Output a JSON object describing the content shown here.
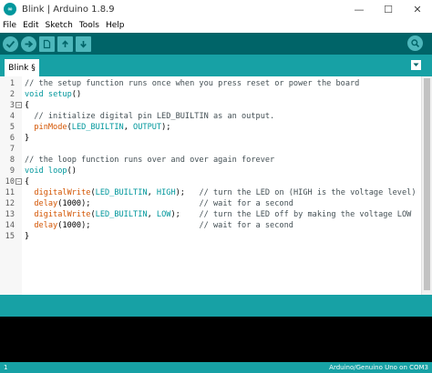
{
  "window": {
    "title": "Blink | Arduino 1.8.9",
    "minimize": "—",
    "maximize": "☐",
    "close": "✕"
  },
  "menu": [
    "File",
    "Edit",
    "Sketch",
    "Tools",
    "Help"
  ],
  "toolbar": {
    "verify_icon": "check-icon",
    "upload_icon": "arrow-right-icon",
    "new_icon": "file-icon",
    "open_icon": "arrow-up-icon",
    "save_icon": "arrow-down-icon",
    "serial_icon": "magnifier-icon"
  },
  "tabs": [
    {
      "label": "Blink §"
    }
  ],
  "editor": {
    "lines": [
      {
        "n": "1",
        "fold": "",
        "parts": [
          [
            "c-comment",
            "// the setup function runs once when you press reset or power the board"
          ]
        ]
      },
      {
        "n": "2",
        "fold": "",
        "parts": [
          [
            "c-kw",
            "void"
          ],
          [
            "c-plain",
            " "
          ],
          [
            "c-kw",
            "setup"
          ],
          [
            "c-plain",
            "()"
          ]
        ]
      },
      {
        "n": "3",
        "fold": "−",
        "parts": [
          [
            "c-plain",
            "{"
          ]
        ]
      },
      {
        "n": "4",
        "fold": "",
        "parts": [
          [
            "c-plain",
            "  "
          ],
          [
            "c-comment",
            "// initialize digital pin LED_BUILTIN as an output."
          ]
        ]
      },
      {
        "n": "5",
        "fold": "",
        "parts": [
          [
            "c-plain",
            "  "
          ],
          [
            "c-fn",
            "pinMode"
          ],
          [
            "c-plain",
            "("
          ],
          [
            "c-const",
            "LED_BUILTIN"
          ],
          [
            "c-plain",
            ", "
          ],
          [
            "c-const",
            "OUTPUT"
          ],
          [
            "c-plain",
            ");"
          ]
        ]
      },
      {
        "n": "6",
        "fold": "",
        "parts": [
          [
            "c-plain",
            "}"
          ]
        ]
      },
      {
        "n": "7",
        "fold": "",
        "parts": [
          [
            "c-plain",
            ""
          ]
        ]
      },
      {
        "n": "8",
        "fold": "",
        "parts": [
          [
            "c-comment",
            "// the loop function runs over and over again forever"
          ]
        ]
      },
      {
        "n": "9",
        "fold": "",
        "parts": [
          [
            "c-kw",
            "void"
          ],
          [
            "c-plain",
            " "
          ],
          [
            "c-kw",
            "loop"
          ],
          [
            "c-plain",
            "()"
          ]
        ]
      },
      {
        "n": "10",
        "fold": "−",
        "parts": [
          [
            "c-plain",
            "{"
          ]
        ]
      },
      {
        "n": "11",
        "fold": "",
        "parts": [
          [
            "c-plain",
            "  "
          ],
          [
            "c-fn",
            "digitalWrite"
          ],
          [
            "c-plain",
            "("
          ],
          [
            "c-const",
            "LED_BUILTIN"
          ],
          [
            "c-plain",
            ", "
          ],
          [
            "c-const",
            "HIGH"
          ],
          [
            "c-plain",
            ");   "
          ],
          [
            "c-comment",
            "// turn the LED on (HIGH is the voltage level)"
          ]
        ]
      },
      {
        "n": "12",
        "fold": "",
        "parts": [
          [
            "c-plain",
            "  "
          ],
          [
            "c-fn",
            "delay"
          ],
          [
            "c-plain",
            "(1000);                       "
          ],
          [
            "c-comment",
            "// wait for a second"
          ]
        ]
      },
      {
        "n": "13",
        "fold": "",
        "parts": [
          [
            "c-plain",
            "  "
          ],
          [
            "c-fn",
            "digitalWrite"
          ],
          [
            "c-plain",
            "("
          ],
          [
            "c-const",
            "LED_BUILTIN"
          ],
          [
            "c-plain",
            ", "
          ],
          [
            "c-const",
            "LOW"
          ],
          [
            "c-plain",
            ");    "
          ],
          [
            "c-comment",
            "// turn the LED off by making the voltage LOW"
          ]
        ]
      },
      {
        "n": "14",
        "fold": "",
        "parts": [
          [
            "c-plain",
            "  "
          ],
          [
            "c-fn",
            "delay"
          ],
          [
            "c-plain",
            "(1000);                       "
          ],
          [
            "c-comment",
            "// wait for a second"
          ]
        ]
      },
      {
        "n": "15",
        "fold": "",
        "parts": [
          [
            "c-plain",
            "}"
          ]
        ]
      }
    ]
  },
  "status": {
    "line": "1",
    "board": "Arduino/Genuino Uno on COM3"
  },
  "colors": {
    "toolbar": "#006468",
    "accent": "#17a1a5",
    "button": "#4db7bb",
    "console": "#000000"
  }
}
